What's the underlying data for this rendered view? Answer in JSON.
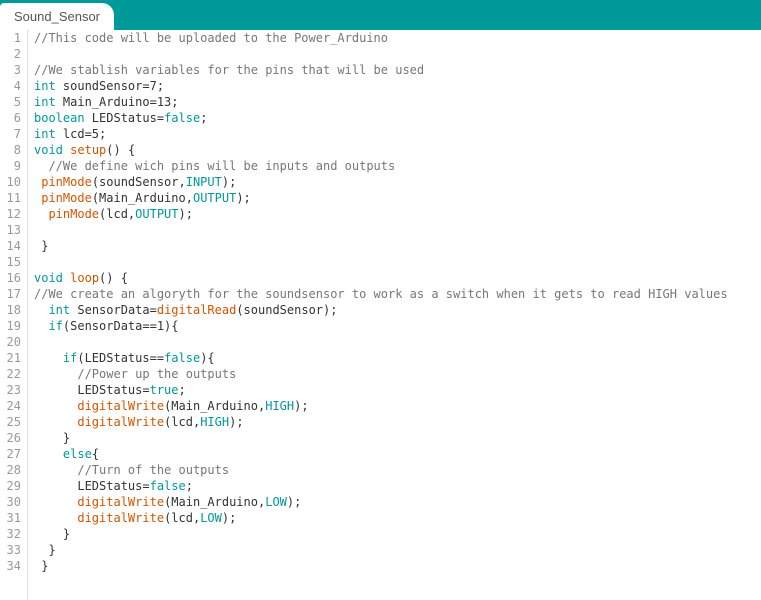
{
  "tab": {
    "title": "Sound_Sensor"
  },
  "lines": [
    {
      "n": 1,
      "tokens": [
        {
          "c": "cm",
          "t": "//This code will be uploaded to the Power_Arduino"
        }
      ]
    },
    {
      "n": 2,
      "tokens": []
    },
    {
      "n": 3,
      "tokens": [
        {
          "c": "cm",
          "t": "//We stablish variables for the pins that will be used"
        }
      ]
    },
    {
      "n": 4,
      "tokens": [
        {
          "c": "kw",
          "t": "int"
        },
        {
          "c": "id",
          "t": " soundSensor=7;"
        }
      ]
    },
    {
      "n": 5,
      "tokens": [
        {
          "c": "kw",
          "t": "int"
        },
        {
          "c": "id",
          "t": " Main_Arduino=13;"
        }
      ]
    },
    {
      "n": 6,
      "tokens": [
        {
          "c": "kw",
          "t": "boolean"
        },
        {
          "c": "id",
          "t": " LEDStatus="
        },
        {
          "c": "bool",
          "t": "false"
        },
        {
          "c": "id",
          "t": ";"
        }
      ]
    },
    {
      "n": 7,
      "tokens": [
        {
          "c": "kw",
          "t": "int"
        },
        {
          "c": "id",
          "t": " lcd=5;"
        }
      ]
    },
    {
      "n": 8,
      "tokens": [
        {
          "c": "kw",
          "t": "void"
        },
        {
          "c": "id",
          "t": " "
        },
        {
          "c": "fn",
          "t": "setup"
        },
        {
          "c": "id",
          "t": "() {"
        }
      ]
    },
    {
      "n": 9,
      "tokens": [
        {
          "c": "id",
          "t": "  "
        },
        {
          "c": "cm",
          "t": "//We define wich pins will be inputs and outputs"
        }
      ]
    },
    {
      "n": 10,
      "tokens": [
        {
          "c": "id",
          "t": " "
        },
        {
          "c": "fn",
          "t": "pinMode"
        },
        {
          "c": "id",
          "t": "(soundSensor,"
        },
        {
          "c": "const",
          "t": "INPUT"
        },
        {
          "c": "id",
          "t": ");"
        }
      ]
    },
    {
      "n": 11,
      "tokens": [
        {
          "c": "id",
          "t": " "
        },
        {
          "c": "fn",
          "t": "pinMode"
        },
        {
          "c": "id",
          "t": "(Main_Arduino,"
        },
        {
          "c": "const",
          "t": "OUTPUT"
        },
        {
          "c": "id",
          "t": ");"
        }
      ]
    },
    {
      "n": 12,
      "tokens": [
        {
          "c": "id",
          "t": "  "
        },
        {
          "c": "fn",
          "t": "pinMode"
        },
        {
          "c": "id",
          "t": "(lcd,"
        },
        {
          "c": "const",
          "t": "OUTPUT"
        },
        {
          "c": "id",
          "t": ");"
        }
      ]
    },
    {
      "n": 13,
      "tokens": []
    },
    {
      "n": 14,
      "tokens": [
        {
          "c": "id",
          "t": " }"
        }
      ]
    },
    {
      "n": 15,
      "tokens": []
    },
    {
      "n": 16,
      "tokens": [
        {
          "c": "kw",
          "t": "void"
        },
        {
          "c": "id",
          "t": " "
        },
        {
          "c": "fn",
          "t": "loop"
        },
        {
          "c": "id",
          "t": "() {"
        }
      ]
    },
    {
      "n": 17,
      "tokens": [
        {
          "c": "cm",
          "t": "//We create an algoryth for the soundsensor to work as a switch when it gets to read HIGH values"
        }
      ]
    },
    {
      "n": 18,
      "tokens": [
        {
          "c": "id",
          "t": "  "
        },
        {
          "c": "kw",
          "t": "int"
        },
        {
          "c": "id",
          "t": " SensorData="
        },
        {
          "c": "fn",
          "t": "digitalRead"
        },
        {
          "c": "id",
          "t": "(soundSensor);"
        }
      ]
    },
    {
      "n": 19,
      "tokens": [
        {
          "c": "id",
          "t": "  "
        },
        {
          "c": "kw",
          "t": "if"
        },
        {
          "c": "id",
          "t": "(SensorData==1){"
        }
      ]
    },
    {
      "n": 20,
      "tokens": []
    },
    {
      "n": 21,
      "tokens": [
        {
          "c": "id",
          "t": "    "
        },
        {
          "c": "kw",
          "t": "if"
        },
        {
          "c": "id",
          "t": "(LEDStatus=="
        },
        {
          "c": "bool",
          "t": "false"
        },
        {
          "c": "id",
          "t": "){"
        }
      ]
    },
    {
      "n": 22,
      "tokens": [
        {
          "c": "id",
          "t": "      "
        },
        {
          "c": "cm",
          "t": "//Power up the outputs"
        }
      ]
    },
    {
      "n": 23,
      "tokens": [
        {
          "c": "id",
          "t": "      LEDStatus="
        },
        {
          "c": "bool",
          "t": "true"
        },
        {
          "c": "id",
          "t": ";"
        }
      ]
    },
    {
      "n": 24,
      "tokens": [
        {
          "c": "id",
          "t": "      "
        },
        {
          "c": "fn",
          "t": "digitalWrite"
        },
        {
          "c": "id",
          "t": "(Main_Arduino,"
        },
        {
          "c": "const",
          "t": "HIGH"
        },
        {
          "c": "id",
          "t": ");"
        }
      ]
    },
    {
      "n": 25,
      "tokens": [
        {
          "c": "id",
          "t": "      "
        },
        {
          "c": "fn",
          "t": "digitalWrite"
        },
        {
          "c": "id",
          "t": "(lcd,"
        },
        {
          "c": "const",
          "t": "HIGH"
        },
        {
          "c": "id",
          "t": ");"
        }
      ]
    },
    {
      "n": 26,
      "tokens": [
        {
          "c": "id",
          "t": "    }"
        }
      ]
    },
    {
      "n": 27,
      "tokens": [
        {
          "c": "id",
          "t": "    "
        },
        {
          "c": "kw",
          "t": "else"
        },
        {
          "c": "id",
          "t": "{"
        }
      ]
    },
    {
      "n": 28,
      "tokens": [
        {
          "c": "id",
          "t": "      "
        },
        {
          "c": "cm",
          "t": "//Turn of the outputs"
        }
      ]
    },
    {
      "n": 29,
      "tokens": [
        {
          "c": "id",
          "t": "      LEDStatus="
        },
        {
          "c": "bool",
          "t": "false"
        },
        {
          "c": "id",
          "t": ";"
        }
      ]
    },
    {
      "n": 30,
      "tokens": [
        {
          "c": "id",
          "t": "      "
        },
        {
          "c": "fn",
          "t": "digitalWrite"
        },
        {
          "c": "id",
          "t": "(Main_Arduino,"
        },
        {
          "c": "const",
          "t": "LOW"
        },
        {
          "c": "id",
          "t": ");"
        }
      ]
    },
    {
      "n": 31,
      "tokens": [
        {
          "c": "id",
          "t": "      "
        },
        {
          "c": "fn",
          "t": "digitalWrite"
        },
        {
          "c": "id",
          "t": "(lcd,"
        },
        {
          "c": "const",
          "t": "LOW"
        },
        {
          "c": "id",
          "t": ");"
        }
      ]
    },
    {
      "n": 32,
      "tokens": [
        {
          "c": "id",
          "t": "    }"
        }
      ]
    },
    {
      "n": 33,
      "tokens": [
        {
          "c": "id",
          "t": "  }"
        }
      ]
    },
    {
      "n": 34,
      "tokens": [
        {
          "c": "id",
          "t": " }"
        }
      ]
    }
  ]
}
